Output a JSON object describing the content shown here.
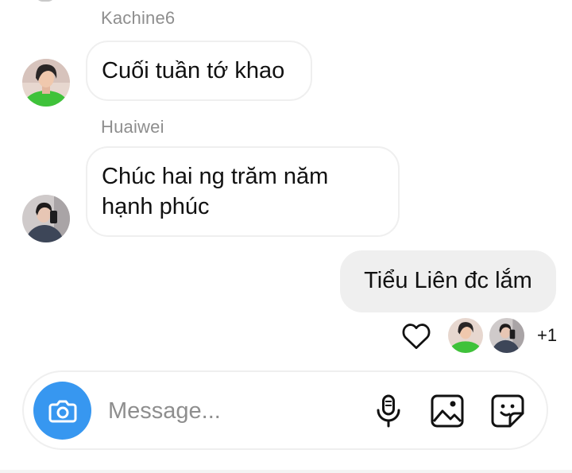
{
  "messages": [
    {
      "sender": "Kachine6",
      "text": "Cuối tuần tớ khao",
      "direction": "incoming",
      "avatar": "green-shirt-avatar"
    },
    {
      "sender": "Huaiwei",
      "text": "Chúc hai ng trăm năm\nhạnh phúc",
      "direction": "incoming",
      "avatar": "mirror-selfie-avatar"
    },
    {
      "sender": "",
      "text": "Tiểu Liên đc lắm",
      "direction": "outgoing"
    }
  ],
  "reactions": {
    "icon": "heart-outline-icon",
    "more_count": "+1"
  },
  "composer": {
    "placeholder": "Message...",
    "icons": [
      "camera-icon",
      "microphone-icon",
      "gallery-icon",
      "sticker-icon"
    ]
  },
  "colors": {
    "accent": "#3797f0",
    "outgoing_bubble": "#efefef",
    "incoming_border": "#efefef",
    "muted_text": "#8e8e8e",
    "text": "#111111"
  }
}
